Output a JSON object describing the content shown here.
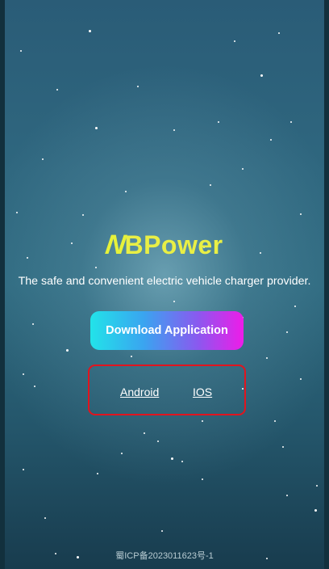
{
  "brand": {
    "logo_mark": "N",
    "logo_text": "BPower",
    "accent_color": "#e9ef45"
  },
  "tagline": "The safe and convenient electric vehicle charger provider.",
  "download_button": {
    "label": "Download Application"
  },
  "links": {
    "android": "Android",
    "ios": "IOS",
    "highlight_border_color": "#e2141e"
  },
  "footer": {
    "icp": "蜀ICP备2023011623号-1"
  }
}
